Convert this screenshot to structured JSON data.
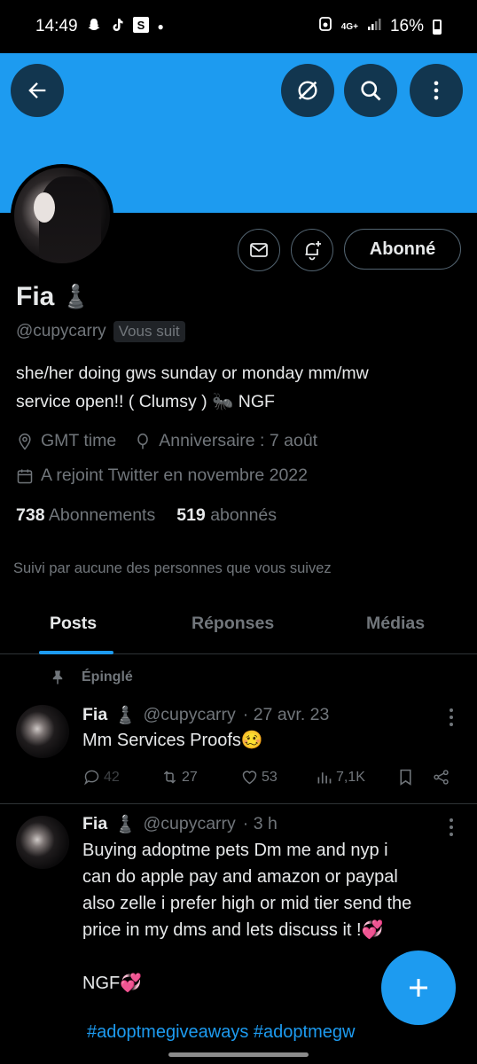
{
  "status_bar": {
    "time": "14:49",
    "notif_icons": [
      "snapchat-icon",
      "tiktok-icon",
      "s-app-icon",
      "dot"
    ],
    "right_icons": [
      "alarm-icon",
      "4g-icon",
      "signal-icon"
    ],
    "network": "4G+",
    "battery": "16%"
  },
  "header": {
    "banner_color": "#1d9bf0",
    "back_icon": "arrow-left-icon",
    "buttons": [
      "grok-icon",
      "search-icon",
      "more-icon"
    ]
  },
  "profile": {
    "name": "Fia",
    "name_emoji": "♟️",
    "handle": "@cupycarry",
    "follows_you_label": "Vous suit",
    "follow_button": "Abonné",
    "bio_line1": "she/her doing gws sunday or monday mm/mw",
    "bio_line2": "service open!! ( Clumsy ) 🐜 NGF",
    "location": "GMT time",
    "birthday": "Anniversaire : 7 août",
    "joined": "A rejoint Twitter en novembre 2022",
    "following_count": "738",
    "following_label": "Abonnements",
    "followers_count": "519",
    "followers_label": "abonnés",
    "followed_by": "Suivi par aucune des personnes que vous suivez"
  },
  "tabs": [
    {
      "label": "Posts",
      "active": true
    },
    {
      "label": "Réponses",
      "active": false
    },
    {
      "label": "Médias",
      "active": false
    }
  ],
  "pinned_label": "Épinglé",
  "tweets": [
    {
      "name": "Fia",
      "emoji": "♟️",
      "handle": "@cupycarry",
      "time": "· 27 avr. 23",
      "text": "Mm Services Proofs🥴",
      "replies": "42",
      "retweets": "27",
      "likes": "53",
      "views": "7,1K"
    },
    {
      "name": "Fia",
      "emoji": "♟️",
      "handle": "@cupycarry",
      "time": "· 3 h",
      "text_lines": [
        "Buying adoptme pets Dm me and nyp i",
        "can do apple pay and amazon or paypal",
        "also zelle i prefer high or mid tier send the",
        "price in my dms and lets discuss it !💞"
      ],
      "text_ngf": "NGF💞",
      "hashtags": "#adoptmegiveaways #adoptmegw"
    }
  ],
  "accent_color": "#1d9bf0"
}
